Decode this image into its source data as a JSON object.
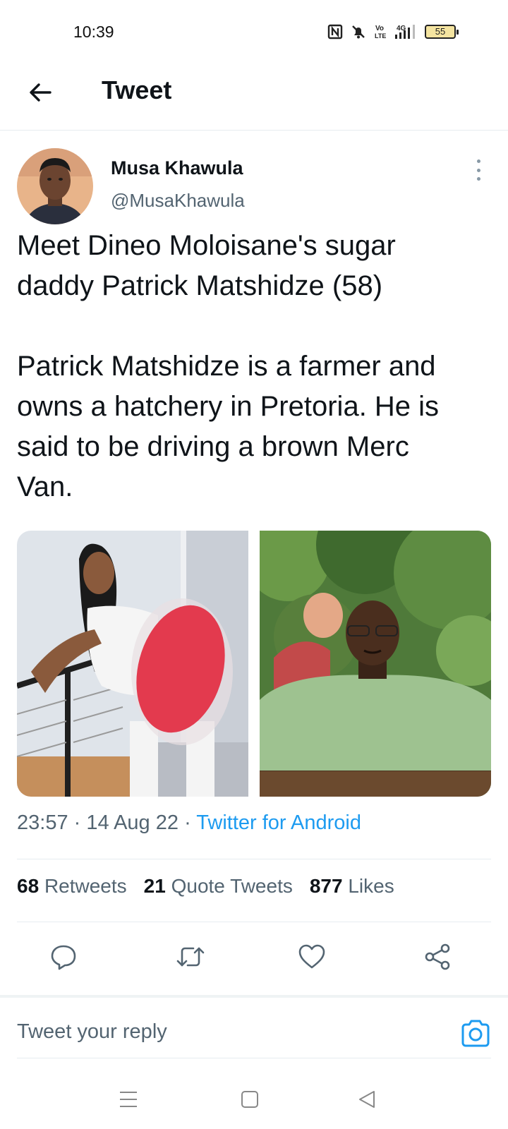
{
  "status_bar": {
    "time": "10:39",
    "icons": [
      "nfc-icon",
      "bell-muted-icon",
      "volte-icon",
      "signal-4g-icon"
    ],
    "battery": "55"
  },
  "header": {
    "title": "Tweet",
    "back_icon": "arrow-left-icon"
  },
  "tweet": {
    "author": {
      "name": "Musa Khawula",
      "handle": "@MusaKhawula"
    },
    "text_lines": [
      "Meet Dineo Moloisane's sugar",
      "daddy Patrick Matshidze (58)",
      "Patrick Matshidze is a farmer and",
      "owns a hatchery in Pretoria. He is",
      "said to be driving a brown Merc",
      "Van."
    ],
    "time": "23:57",
    "date": "14 Aug 22",
    "source": "Twitter for Android",
    "stats": {
      "retweets_count": "68",
      "retweets_label": "Retweets",
      "quotes_count": "21",
      "quotes_label": "Quote Tweets",
      "likes_count": "877",
      "likes_label": "Likes"
    }
  },
  "actions": [
    "reply-icon",
    "retweet-icon",
    "like-icon",
    "share-icon"
  ],
  "reply": {
    "placeholder": "Tweet your reply"
  },
  "colors": {
    "accent": "#1d9bf0",
    "text": "#0f1419",
    "secondary_text": "#536471",
    "divider": "#e6ecf0"
  }
}
